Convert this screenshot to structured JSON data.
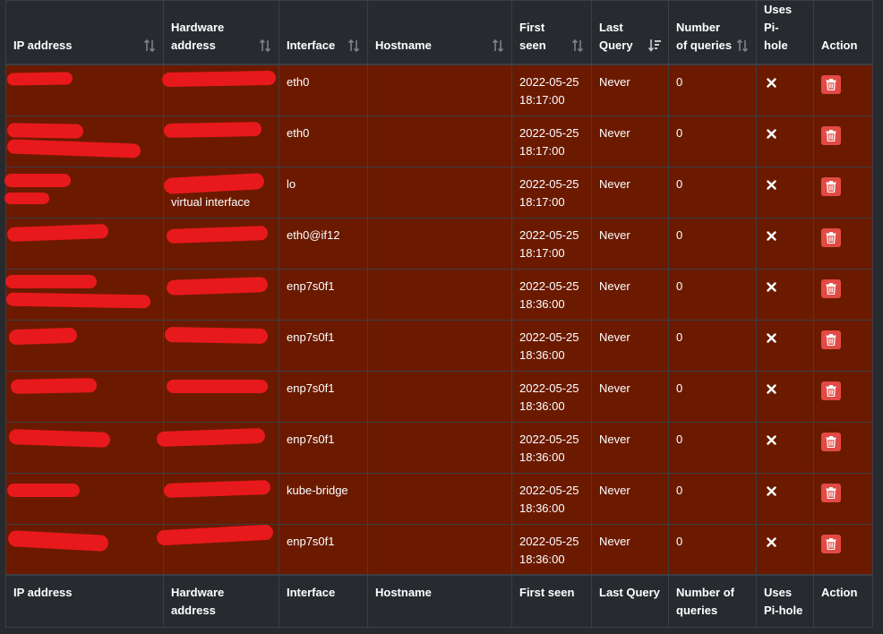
{
  "columns": [
    {
      "label": "IP address",
      "sort": "both"
    },
    {
      "label": "Hardware address",
      "sort": "both"
    },
    {
      "label": "Interface",
      "sort": "both"
    },
    {
      "label": "Hostname",
      "sort": "both"
    },
    {
      "label": "First seen",
      "sort": "both"
    },
    {
      "label": "Last Query",
      "sort": "desc"
    },
    {
      "label": "Number of queries",
      "sort": "both"
    },
    {
      "label": "Uses Pi-hole",
      "sort": "none"
    },
    {
      "label": "Action",
      "sort": "none"
    }
  ],
  "footer": [
    "IP address",
    "Hardware address",
    "Interface",
    "Hostname",
    "First seen",
    "Last Query",
    "Number of queries",
    "Uses Pi-hole",
    "Action"
  ],
  "rows": [
    {
      "ip": "",
      "mac": "",
      "mac_extra": "",
      "interface": "eth0",
      "hostname": "",
      "first_seen": "2022-05-25 18:17:00",
      "last_query": "Never",
      "queries": "0"
    },
    {
      "ip": "",
      "mac": "",
      "mac_extra": "",
      "interface": "eth0",
      "hostname": "",
      "first_seen": "2022-05-25 18:17:00",
      "last_query": "Never",
      "queries": "0"
    },
    {
      "ip": "",
      "mac": "",
      "mac_extra": "virtual interface",
      "interface": "lo",
      "hostname": "",
      "first_seen": "2022-05-25 18:17:00",
      "last_query": "Never",
      "queries": "0"
    },
    {
      "ip": "",
      "mac": "",
      "mac_extra": "",
      "interface": "eth0@if12",
      "hostname": "",
      "first_seen": "2022-05-25 18:17:00",
      "last_query": "Never",
      "queries": "0"
    },
    {
      "ip": "",
      "mac": "",
      "mac_extra": "",
      "interface": "enp7s0f1",
      "hostname": "",
      "first_seen": "2022-05-25 18:36:00",
      "last_query": "Never",
      "queries": "0"
    },
    {
      "ip": "",
      "mac": "",
      "mac_extra": "",
      "interface": "enp7s0f1",
      "hostname": "",
      "first_seen": "2022-05-25 18:36:00",
      "last_query": "Never",
      "queries": "0"
    },
    {
      "ip": "",
      "mac": "",
      "mac_extra": "",
      "interface": "enp7s0f1",
      "hostname": "",
      "first_seen": "2022-05-25 18:36:00",
      "last_query": "Never",
      "queries": "0"
    },
    {
      "ip": "",
      "mac": "",
      "mac_extra": "",
      "interface": "enp7s0f1",
      "hostname": "",
      "first_seen": "2022-05-25 18:36:00",
      "last_query": "Never",
      "queries": "0"
    },
    {
      "ip": "",
      "mac": "",
      "mac_extra": "",
      "interface": "kube-bridge",
      "hostname": "",
      "first_seen": "2022-05-25 18:36:00",
      "last_query": "Never",
      "queries": "0"
    },
    {
      "ip": "",
      "mac": "",
      "mac_extra": "",
      "interface": "enp7s0f1",
      "hostname": "",
      "first_seen": "2022-05-25 18:36:00",
      "last_query": "Never",
      "queries": "0"
    }
  ],
  "icons": {
    "uses_pihole": "times-icon",
    "action": "trash-icon"
  },
  "colors": {
    "background": "#272b30",
    "row_warning": "#6b1a00",
    "delete_button": "#e24a44",
    "redaction": "#e8191c",
    "border": "#3a3f44"
  }
}
